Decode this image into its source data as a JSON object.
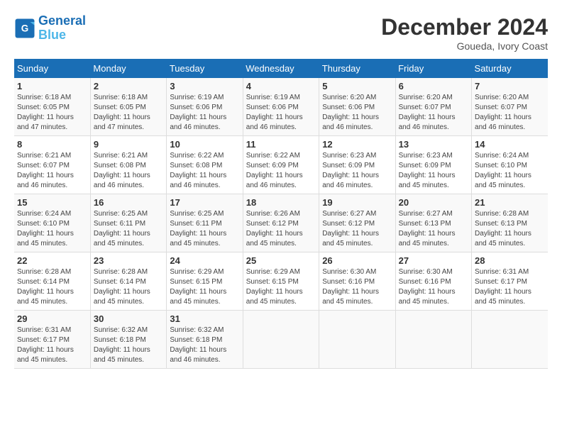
{
  "header": {
    "logo_line1": "General",
    "logo_line2": "Blue",
    "month": "December 2024",
    "location": "Goueda, Ivory Coast"
  },
  "days_of_week": [
    "Sunday",
    "Monday",
    "Tuesday",
    "Wednesday",
    "Thursday",
    "Friday",
    "Saturday"
  ],
  "weeks": [
    [
      {
        "day": "1",
        "sunrise": "6:18 AM",
        "sunset": "6:05 PM",
        "daylight": "11 hours and 47 minutes."
      },
      {
        "day": "2",
        "sunrise": "6:18 AM",
        "sunset": "6:05 PM",
        "daylight": "11 hours and 47 minutes."
      },
      {
        "day": "3",
        "sunrise": "6:19 AM",
        "sunset": "6:06 PM",
        "daylight": "11 hours and 46 minutes."
      },
      {
        "day": "4",
        "sunrise": "6:19 AM",
        "sunset": "6:06 PM",
        "daylight": "11 hours and 46 minutes."
      },
      {
        "day": "5",
        "sunrise": "6:20 AM",
        "sunset": "6:06 PM",
        "daylight": "11 hours and 46 minutes."
      },
      {
        "day": "6",
        "sunrise": "6:20 AM",
        "sunset": "6:07 PM",
        "daylight": "11 hours and 46 minutes."
      },
      {
        "day": "7",
        "sunrise": "6:20 AM",
        "sunset": "6:07 PM",
        "daylight": "11 hours and 46 minutes."
      }
    ],
    [
      {
        "day": "8",
        "sunrise": "6:21 AM",
        "sunset": "6:07 PM",
        "daylight": "11 hours and 46 minutes."
      },
      {
        "day": "9",
        "sunrise": "6:21 AM",
        "sunset": "6:08 PM",
        "daylight": "11 hours and 46 minutes."
      },
      {
        "day": "10",
        "sunrise": "6:22 AM",
        "sunset": "6:08 PM",
        "daylight": "11 hours and 46 minutes."
      },
      {
        "day": "11",
        "sunrise": "6:22 AM",
        "sunset": "6:09 PM",
        "daylight": "11 hours and 46 minutes."
      },
      {
        "day": "12",
        "sunrise": "6:23 AM",
        "sunset": "6:09 PM",
        "daylight": "11 hours and 46 minutes."
      },
      {
        "day": "13",
        "sunrise": "6:23 AM",
        "sunset": "6:09 PM",
        "daylight": "11 hours and 45 minutes."
      },
      {
        "day": "14",
        "sunrise": "6:24 AM",
        "sunset": "6:10 PM",
        "daylight": "11 hours and 45 minutes."
      }
    ],
    [
      {
        "day": "15",
        "sunrise": "6:24 AM",
        "sunset": "6:10 PM",
        "daylight": "11 hours and 45 minutes."
      },
      {
        "day": "16",
        "sunrise": "6:25 AM",
        "sunset": "6:11 PM",
        "daylight": "11 hours and 45 minutes."
      },
      {
        "day": "17",
        "sunrise": "6:25 AM",
        "sunset": "6:11 PM",
        "daylight": "11 hours and 45 minutes."
      },
      {
        "day": "18",
        "sunrise": "6:26 AM",
        "sunset": "6:12 PM",
        "daylight": "11 hours and 45 minutes."
      },
      {
        "day": "19",
        "sunrise": "6:27 AM",
        "sunset": "6:12 PM",
        "daylight": "11 hours and 45 minutes."
      },
      {
        "day": "20",
        "sunrise": "6:27 AM",
        "sunset": "6:13 PM",
        "daylight": "11 hours and 45 minutes."
      },
      {
        "day": "21",
        "sunrise": "6:28 AM",
        "sunset": "6:13 PM",
        "daylight": "11 hours and 45 minutes."
      }
    ],
    [
      {
        "day": "22",
        "sunrise": "6:28 AM",
        "sunset": "6:14 PM",
        "daylight": "11 hours and 45 minutes."
      },
      {
        "day": "23",
        "sunrise": "6:28 AM",
        "sunset": "6:14 PM",
        "daylight": "11 hours and 45 minutes."
      },
      {
        "day": "24",
        "sunrise": "6:29 AM",
        "sunset": "6:15 PM",
        "daylight": "11 hours and 45 minutes."
      },
      {
        "day": "25",
        "sunrise": "6:29 AM",
        "sunset": "6:15 PM",
        "daylight": "11 hours and 45 minutes."
      },
      {
        "day": "26",
        "sunrise": "6:30 AM",
        "sunset": "6:16 PM",
        "daylight": "11 hours and 45 minutes."
      },
      {
        "day": "27",
        "sunrise": "6:30 AM",
        "sunset": "6:16 PM",
        "daylight": "11 hours and 45 minutes."
      },
      {
        "day": "28",
        "sunrise": "6:31 AM",
        "sunset": "6:17 PM",
        "daylight": "11 hours and 45 minutes."
      }
    ],
    [
      {
        "day": "29",
        "sunrise": "6:31 AM",
        "sunset": "6:17 PM",
        "daylight": "11 hours and 45 minutes."
      },
      {
        "day": "30",
        "sunrise": "6:32 AM",
        "sunset": "6:18 PM",
        "daylight": "11 hours and 45 minutes."
      },
      {
        "day": "31",
        "sunrise": "6:32 AM",
        "sunset": "6:18 PM",
        "daylight": "11 hours and 46 minutes."
      },
      null,
      null,
      null,
      null
    ]
  ],
  "labels": {
    "sunrise": "Sunrise:",
    "sunset": "Sunset:",
    "daylight": "Daylight:"
  }
}
